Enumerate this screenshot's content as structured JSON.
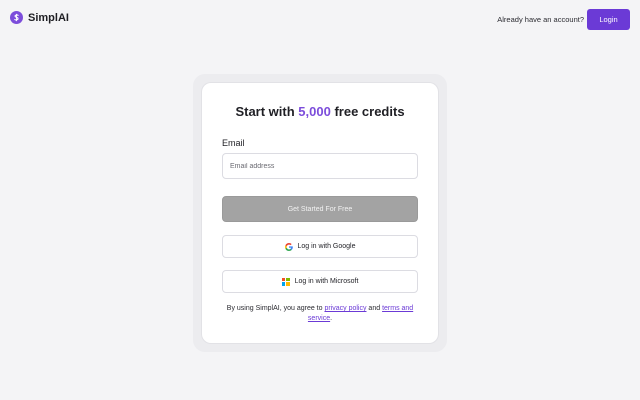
{
  "header": {
    "brand_name": "SimplAI",
    "brand_icon": "dollar-coin-icon",
    "already_text": "Already have an account?",
    "login_label": "Login"
  },
  "card": {
    "title_prefix": "Start with ",
    "title_accent": "5,000",
    "title_suffix": " free credits",
    "email_label": "Email",
    "email_placeholder": "Email address",
    "email_value": "",
    "cta_label": "Get Started For Free",
    "google_label": "Log in with Google",
    "microsoft_label": "Log in with Microsoft",
    "legal_prefix": "By using SimplAI, you agree to ",
    "privacy_label": "privacy policy",
    "legal_and": " and ",
    "terms_label": "terms and service",
    "legal_suffix": "."
  },
  "colors": {
    "accent": "#7c4ddb",
    "login_button": "#6b3ad6",
    "cta_disabled": "#a3a3a3",
    "background": "#f4f4f6"
  }
}
